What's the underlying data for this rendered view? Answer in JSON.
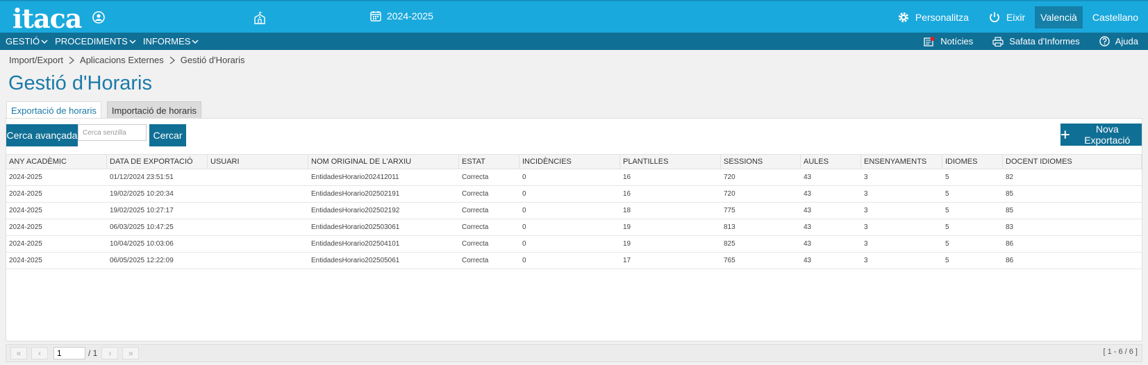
{
  "header": {
    "logo": "itaca",
    "year": "2024-2025",
    "personalize": "Personalitza",
    "exit": "Eixir",
    "lang_active": "Valencià",
    "lang_other": "Castellano"
  },
  "menu": {
    "left": [
      {
        "label": "GESTIÓ"
      },
      {
        "label": "PROCEDIMENTS"
      },
      {
        "label": "INFORMES"
      }
    ],
    "news": "Notícies",
    "reports_tray": "Safata d'Informes",
    "help": "Ajuda"
  },
  "breadcrumb": [
    "Import/Export",
    "Aplicacions Externes",
    "Gestió d'Horaris"
  ],
  "page_title": "Gestió d'Horaris",
  "tabs": [
    {
      "label": "Exportació de horaris",
      "active": true
    },
    {
      "label": "Importació de horaris",
      "active": false
    }
  ],
  "toolbar": {
    "advanced_search": "Cerca avançada",
    "search_placeholder": "Cerca senzilla",
    "search": "Cercar",
    "new_export": "Nova Exportació"
  },
  "table": {
    "columns": [
      "ANY ACADÈMIC",
      "DATA DE EXPORTACIÓ",
      "USUARI",
      "NOM ORIGINAL DE L'ARXIU",
      "ESTAT",
      "INCIDÈNCIES",
      "PLANTILLES",
      "SESSIONS",
      "AULES",
      "ENSENYAMENTS",
      "IDIOMES",
      "DOCENT IDIOMES"
    ],
    "rows": [
      [
        "2024-2025",
        "01/12/2024 23:51:51",
        "",
        "EntidadesHorario202412011",
        "Correcta",
        "0",
        "16",
        "720",
        "43",
        "3",
        "5",
        "82"
      ],
      [
        "2024-2025",
        "19/02/2025 10:20:34",
        "",
        "EntidadesHorario202502191",
        "Correcta",
        "0",
        "16",
        "720",
        "43",
        "3",
        "5",
        "85"
      ],
      [
        "2024-2025",
        "19/02/2025 10:27:17",
        "",
        "EntidadesHorario202502192",
        "Correcta",
        "0",
        "18",
        "775",
        "43",
        "3",
        "5",
        "85"
      ],
      [
        "2024-2025",
        "06/03/2025 10:47:25",
        "",
        "EntidadesHorario202503061",
        "Correcta",
        "0",
        "19",
        "813",
        "43",
        "3",
        "5",
        "83"
      ],
      [
        "2024-2025",
        "10/04/2025 10:03:06",
        "",
        "EntidadesHorario202504101",
        "Correcta",
        "0",
        "19",
        "825",
        "43",
        "3",
        "5",
        "86"
      ],
      [
        "2024-2025",
        "06/05/2025 12:22:09",
        "",
        "EntidadesHorario202505061",
        "Correcta",
        "0",
        "17",
        "765",
        "43",
        "3",
        "5",
        "86"
      ]
    ]
  },
  "pager": {
    "page": "1",
    "total": "/ 1",
    "range": "[ 1 - 6 / 6 ]"
  },
  "colors": {
    "top": "#1aa9dd",
    "menu": "#106f95",
    "title": "#1a7aa8"
  }
}
